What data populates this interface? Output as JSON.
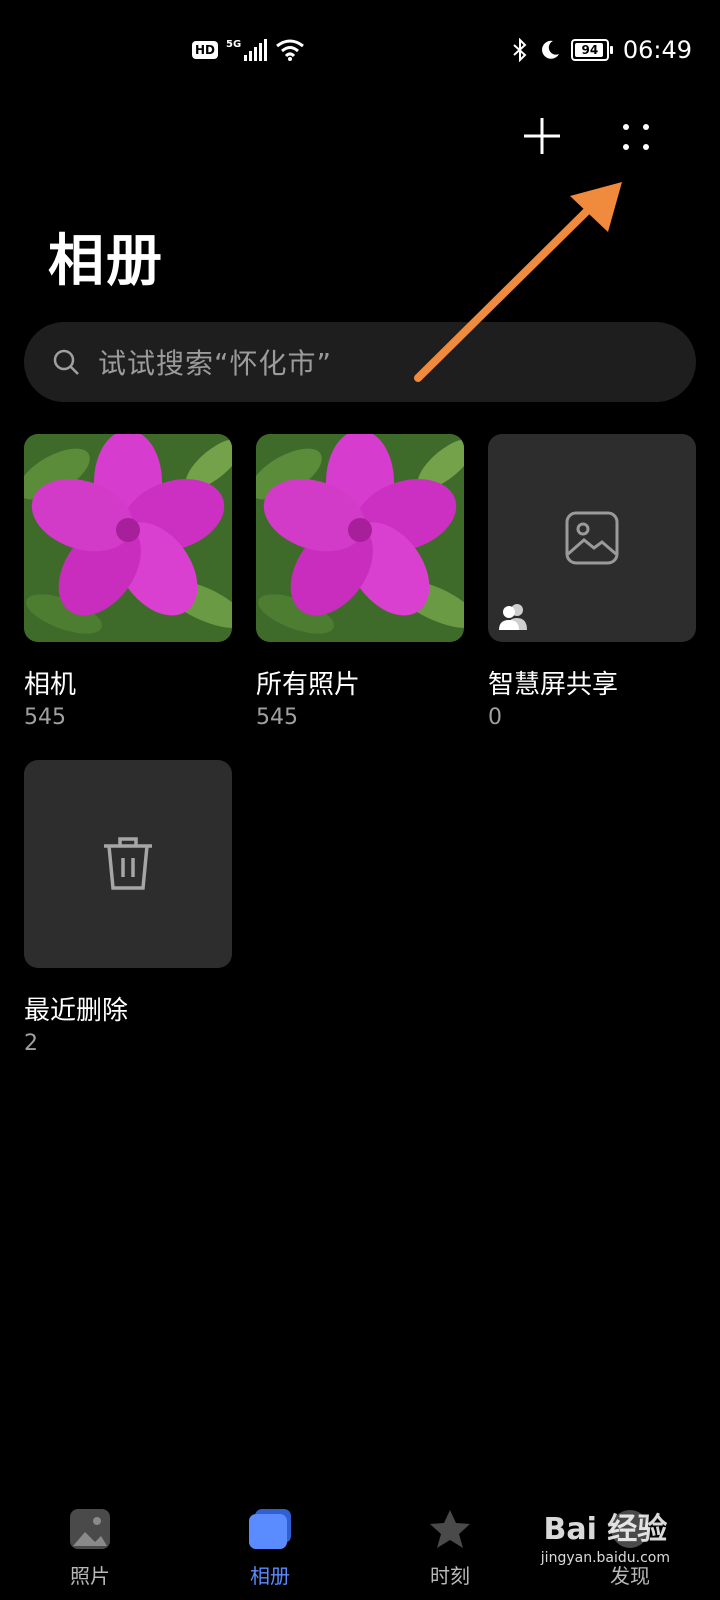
{
  "status_bar": {
    "hd_badge": "HD",
    "network": "5G",
    "battery": "94",
    "battery_level": 0.94,
    "time": "06:49"
  },
  "header": {
    "title": "相册",
    "add_icon": "plus-icon",
    "more_icon": "more-dots-icon"
  },
  "search": {
    "placeholder": "试试搜索“怀化市”"
  },
  "albums": [
    {
      "name": "相机",
      "count": "545",
      "thumb": "flower-photo"
    },
    {
      "name": "所有照片",
      "count": "545",
      "thumb": "flower-photo"
    },
    {
      "name": "智慧屏共享",
      "count": "0",
      "thumb": "image-placeholder-icon"
    },
    {
      "name": "最近删除",
      "count": "2",
      "thumb": "trash-icon"
    }
  ],
  "bottom_nav": [
    {
      "label": "照片",
      "icon": "photo-icon"
    },
    {
      "label": "相册",
      "icon": "album-icon",
      "active": true
    },
    {
      "label": "时刻",
      "icon": "star-icon"
    },
    {
      "label": "发现",
      "icon": "discover-icon"
    }
  ],
  "watermark": {
    "brand": "Bai 经验",
    "url": "jingyan.baidu.com"
  },
  "colors": {
    "background": "#000000",
    "accent": "#5a8bff",
    "annotation_arrow": "#f08a3c",
    "tile_bg": "#2d2d2d"
  }
}
